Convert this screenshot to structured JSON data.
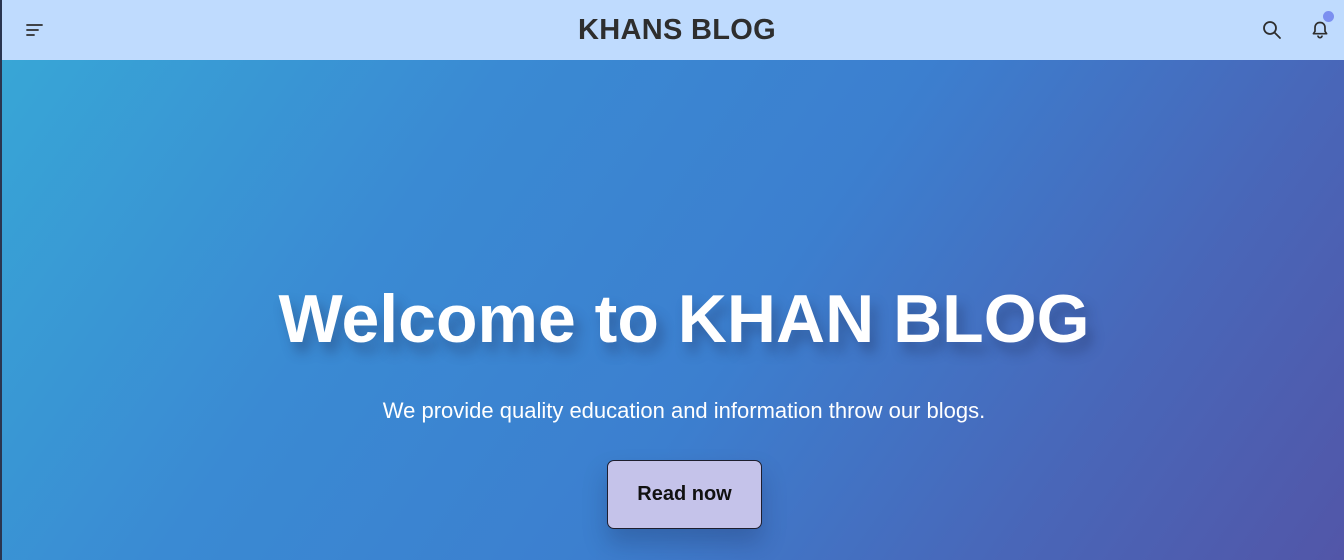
{
  "navbar": {
    "title": "KHANS BLOG",
    "menu_icon": "menu-icon",
    "search_icon": "search-icon",
    "bell_icon": "bell-icon",
    "has_notification": true
  },
  "hero": {
    "title": "Welcome to KHAN BLOG",
    "subtitle": "We provide quality education and information throw our blogs.",
    "cta_label": "Read now"
  },
  "colors": {
    "navbar_bg": "#bfdbfe",
    "hero_gradient_start": "#38a6d6",
    "hero_gradient_end": "#5256a8",
    "button_bg": "#c5c3ea",
    "notification_dot": "#7b8ff0"
  }
}
